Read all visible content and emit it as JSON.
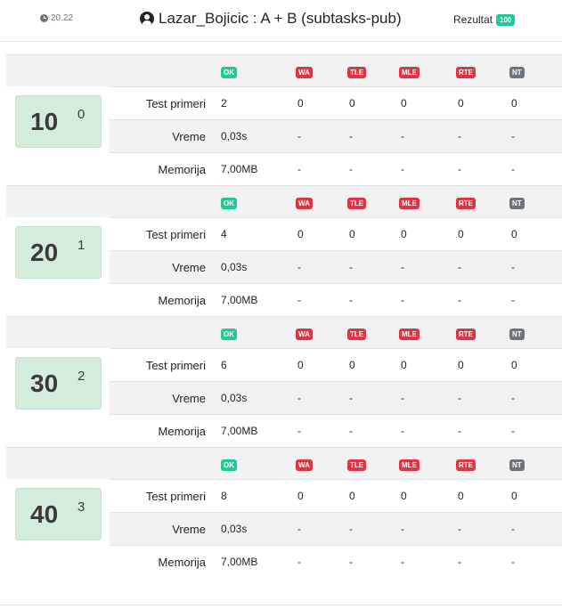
{
  "header": {
    "time": "20.22",
    "title": "Lazar_Bojicic : A + B (subtasks-pub)",
    "result_label": "Rezultat",
    "result_value": "100"
  },
  "statuses": [
    {
      "code": "OK",
      "color": "#20c997"
    },
    {
      "code": "WA",
      "color": "#dc3545"
    },
    {
      "code": "TLE",
      "color": "#dc3545"
    },
    {
      "code": "MLE",
      "color": "#dc3545"
    },
    {
      "code": "RTE",
      "color": "#dc3545"
    },
    {
      "code": "NT",
      "color": "#6c757d"
    }
  ],
  "row_labels": {
    "tests": "Test primeri",
    "time": "Vreme",
    "memory": "Memorija"
  },
  "subtasks": [
    {
      "score": "10",
      "index": "0",
      "tests": [
        "2",
        "0",
        "0",
        "0",
        "0",
        "0"
      ],
      "time": [
        "0,03s",
        "-",
        "-",
        "-",
        "-",
        "-"
      ],
      "memory": [
        "7,00MB",
        "-",
        "-",
        "-",
        "-",
        "-"
      ]
    },
    {
      "score": "20",
      "index": "1",
      "tests": [
        "4",
        "0",
        "0",
        "0",
        "0",
        "0"
      ],
      "time": [
        "0,03s",
        "-",
        "-",
        "-",
        "-",
        "-"
      ],
      "memory": [
        "7,00MB",
        "-",
        "-",
        "-",
        "-",
        "-"
      ]
    },
    {
      "score": "30",
      "index": "2",
      "tests": [
        "6",
        "0",
        "0",
        "0",
        "0",
        "0"
      ],
      "time": [
        "0,03s",
        "-",
        "-",
        "-",
        "-",
        "-"
      ],
      "memory": [
        "7,00MB",
        "-",
        "-",
        "-",
        "-",
        "-"
      ]
    },
    {
      "score": "40",
      "index": "3",
      "tests": [
        "8",
        "0",
        "0",
        "0",
        "0",
        "0"
      ],
      "time": [
        "0,03s",
        "-",
        "-",
        "-",
        "-",
        "-"
      ],
      "memory": [
        "7,00MB",
        "-",
        "-",
        "-",
        "-",
        "-"
      ]
    }
  ]
}
